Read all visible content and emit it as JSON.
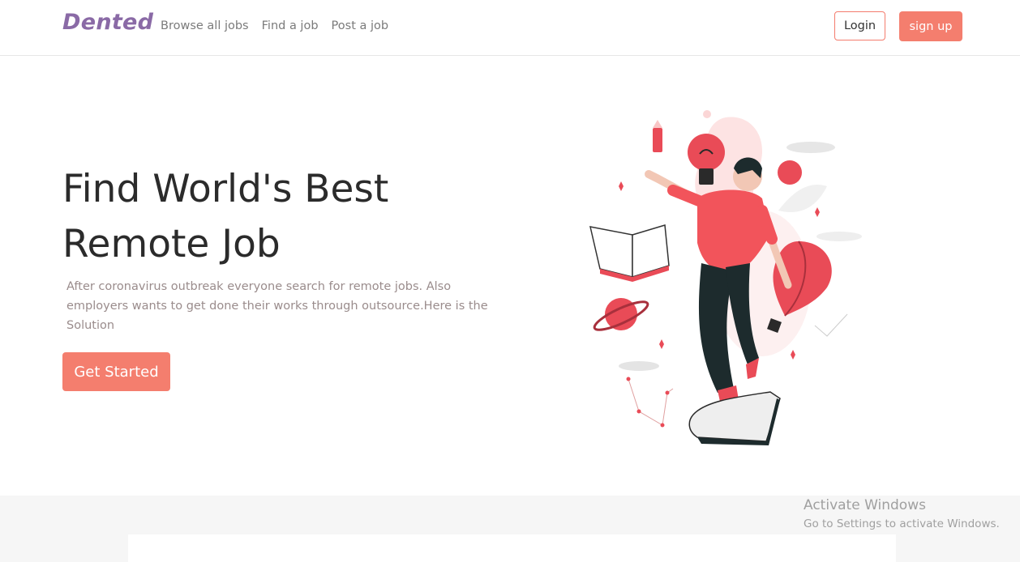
{
  "navbar": {
    "brand": "Dented",
    "links": [
      "Browse all jobs",
      "Find a job",
      "Post a job"
    ],
    "login_label": "Login",
    "signup_label": "sign up"
  },
  "hero": {
    "title_line1": "Find World's Best",
    "title_line2": "Remote Job",
    "description": "After coronavirus outbreak everyone search for remote jobs. Also employers wants to get done their works through outsource.Here is the Solution",
    "cta_label": "Get Started",
    "illustration": "person-floating-with-lightbulb-illustration"
  },
  "watermark": {
    "title": "Activate Windows",
    "subtitle": "Go to Settings to activate Windows."
  },
  "colors": {
    "brand": "#8a6aa6",
    "accent": "#f47e6e",
    "text_dark": "#2b2b2b",
    "text_muted": "#9a8c8c"
  }
}
